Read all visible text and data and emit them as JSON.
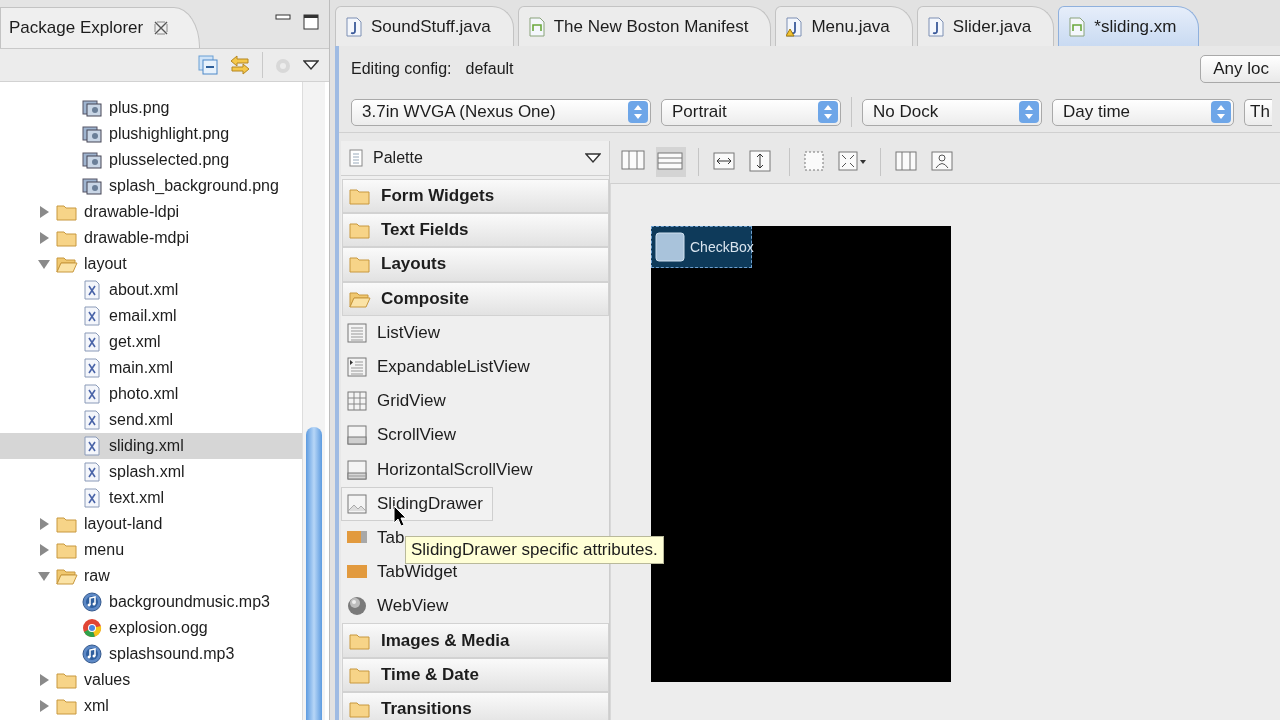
{
  "explorer": {
    "title": "Package Explorer",
    "tree": [
      {
        "children": [
          {
            "label": "plus.png",
            "kind": "image",
            "selected": false
          },
          {
            "label": "plushighlight.png",
            "kind": "image",
            "selected": false
          },
          {
            "label": "plusselected.png",
            "kind": "image",
            "selected": false
          },
          {
            "label": "splash_background.png",
            "kind": "image",
            "selected": false
          }
        ]
      },
      {
        "label": "drawable-ldpi",
        "kind": "folder",
        "expanded": false,
        "selected": false
      },
      {
        "label": "drawable-mdpi",
        "kind": "folder",
        "expanded": false,
        "selected": false
      },
      {
        "label": "layout",
        "kind": "folder",
        "expanded": true,
        "selected": false,
        "children": [
          {
            "label": "about.xml",
            "kind": "xml",
            "selected": false
          },
          {
            "label": "email.xml",
            "kind": "xml",
            "selected": false
          },
          {
            "label": "get.xml",
            "kind": "xml",
            "selected": false
          },
          {
            "label": "main.xml",
            "kind": "xml",
            "selected": false
          },
          {
            "label": "photo.xml",
            "kind": "xml",
            "selected": false
          },
          {
            "label": "send.xml",
            "kind": "xml",
            "selected": false
          },
          {
            "label": "sliding.xml",
            "kind": "xml",
            "selected": true
          },
          {
            "label": "splash.xml",
            "kind": "xml",
            "selected": false
          },
          {
            "label": "text.xml",
            "kind": "xml",
            "selected": false
          }
        ]
      },
      {
        "label": "layout-land",
        "kind": "folder",
        "expanded": false,
        "selected": false
      },
      {
        "label": "menu",
        "kind": "folder",
        "expanded": false,
        "selected": false
      },
      {
        "label": "raw",
        "kind": "folder",
        "expanded": true,
        "selected": false,
        "children": [
          {
            "label": "backgroundmusic.mp3",
            "kind": "audio",
            "selected": false
          },
          {
            "label": "explosion.ogg",
            "kind": "media",
            "selected": false
          },
          {
            "label": "splashsound.mp3",
            "kind": "audio",
            "selected": false
          }
        ]
      },
      {
        "label": "values",
        "kind": "folder",
        "expanded": false,
        "selected": false
      },
      {
        "label": "xml",
        "kind": "folder",
        "expanded": false,
        "selected": false
      }
    ]
  },
  "editor_tabs": [
    {
      "label": "SoundStuff.java",
      "kind": "java",
      "selected": false
    },
    {
      "label": "The New Boston Manifest",
      "kind": "manifest",
      "selected": false
    },
    {
      "label": "Menu.java",
      "kind": "java-warning",
      "selected": false
    },
    {
      "label": "Slider.java",
      "kind": "java",
      "selected": false
    },
    {
      "label": "*sliding.xm",
      "kind": "manifest",
      "selected": true
    }
  ],
  "config": {
    "label": "Editing config:",
    "value": "default",
    "locale_button": "Any loc"
  },
  "dropdowns": [
    {
      "label": "3.7in WVGA (Nexus One)"
    },
    {
      "label": "Portrait"
    },
    {
      "label": "No Dock"
    },
    {
      "label": "Day time"
    },
    {
      "label": "Th"
    }
  ],
  "palette": {
    "title": "Palette",
    "items": [
      {
        "label": "Form Widgets",
        "kind": "category",
        "expanded": false
      },
      {
        "label": "Text Fields",
        "kind": "category",
        "expanded": false
      },
      {
        "label": "Layouts",
        "kind": "category",
        "expanded": false
      },
      {
        "label": "Composite",
        "kind": "category",
        "expanded": true
      },
      {
        "label": "ListView",
        "kind": "widget",
        "highlighted": false
      },
      {
        "label": "ExpandableListView",
        "kind": "widget",
        "highlighted": false
      },
      {
        "label": "GridView",
        "kind": "widget",
        "highlighted": false
      },
      {
        "label": "ScrollView",
        "kind": "widget",
        "highlighted": false
      },
      {
        "label": "HorizontalScrollView",
        "kind": "widget",
        "highlighted": false
      },
      {
        "label": "SlidingDrawer",
        "kind": "widget",
        "highlighted": true
      },
      {
        "label": "Tab",
        "kind": "widget",
        "highlighted": false
      },
      {
        "label": "TabWidget",
        "kind": "widget",
        "highlighted": false
      },
      {
        "label": "WebView",
        "kind": "widget",
        "highlighted": false
      },
      {
        "label": "Images & Media",
        "kind": "category",
        "expanded": false
      },
      {
        "label": "Time & Date",
        "kind": "category",
        "expanded": false
      },
      {
        "label": "Transitions",
        "kind": "category",
        "expanded": false
      }
    ]
  },
  "canvas": {
    "widget": {
      "label": "CheckBox",
      "selected": true
    }
  },
  "tooltip": "SlidingDrawer specific attributes."
}
